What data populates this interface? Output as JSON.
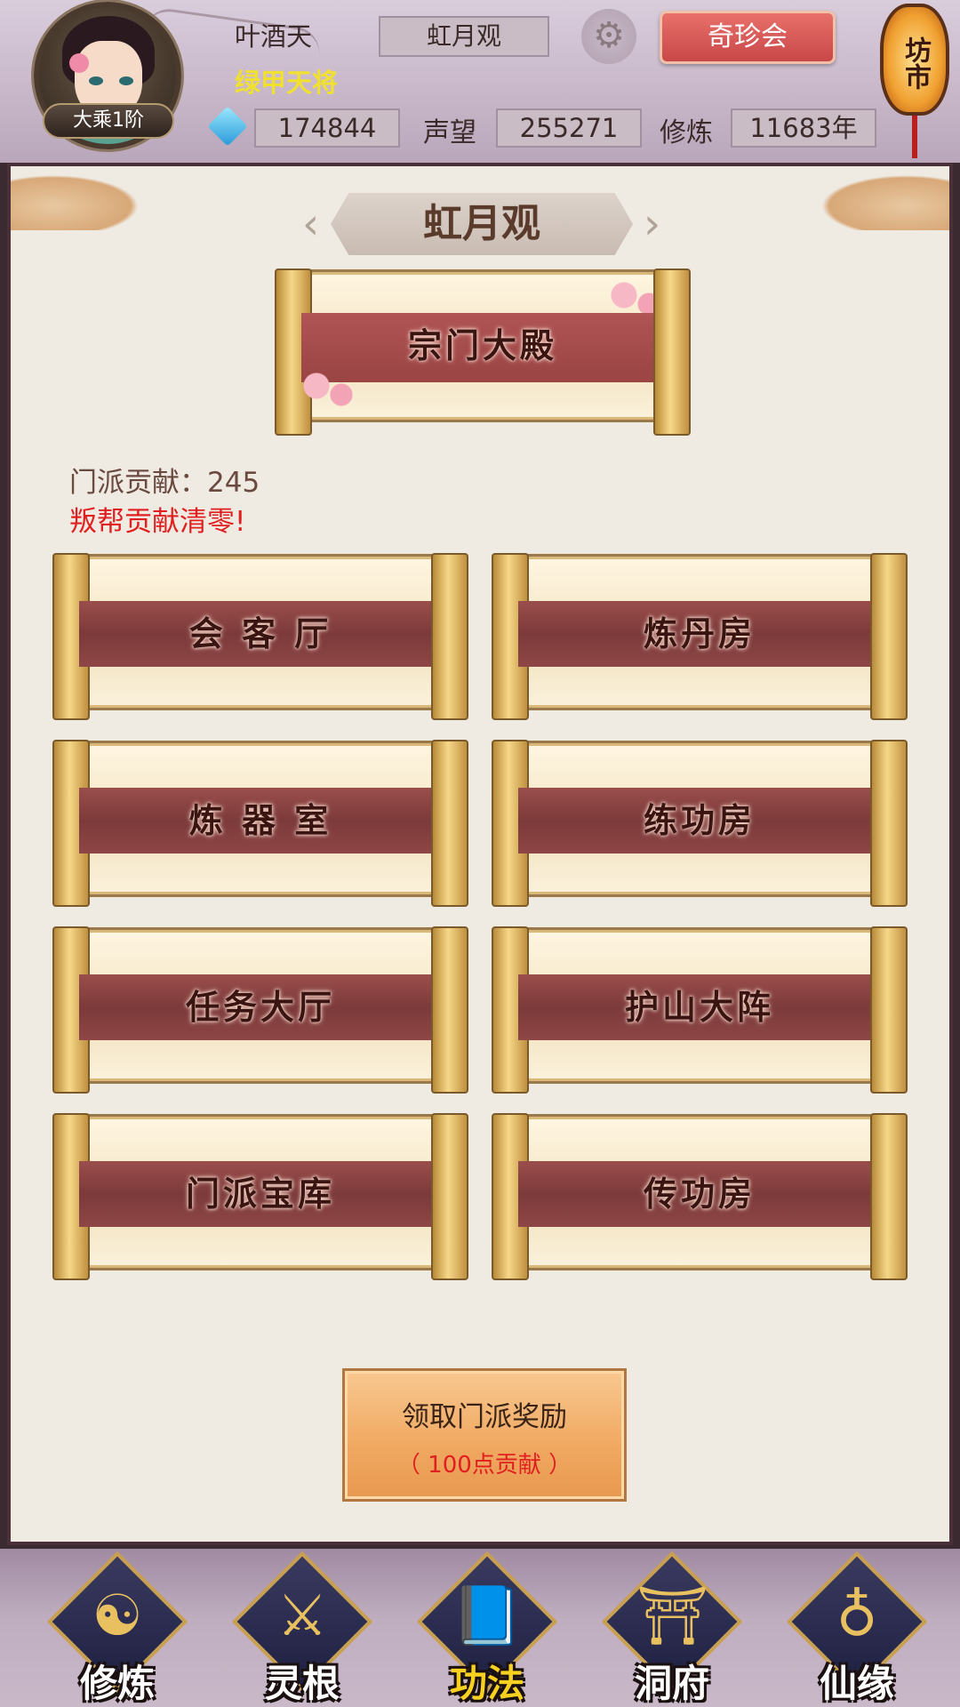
{
  "player": {
    "name": "叶酒天",
    "title": "绿甲天将",
    "rank": "大乘1阶",
    "sect": "虹月观"
  },
  "header": {
    "settings_icon": "gear-icon",
    "treasure_button": "奇珍会",
    "market_lantern": "坊市",
    "currency_icon": "blue-gem-icon",
    "currency_value": "174844",
    "prestige_label": "声望",
    "prestige_value": "255271",
    "cultivation_label": "修炼",
    "cultivation_value": "11683年"
  },
  "sect_panel": {
    "title": "虹月观",
    "main_hall": "宗门大殿",
    "contribution_line": "门派贡献：245",
    "warning": "叛帮贡献清零!",
    "buildings": [
      {
        "label": "会 客 厅"
      },
      {
        "label": "炼丹房"
      },
      {
        "label": "炼 器 室"
      },
      {
        "label": "练功房"
      },
      {
        "label": "任务大厅"
      },
      {
        "label": "护山大阵"
      },
      {
        "label": "门派宝库"
      },
      {
        "label": "传功房"
      }
    ],
    "reward_button": {
      "label": "领取门派奖励",
      "cost": "（ 100点贡献 ）"
    }
  },
  "bottom_nav": {
    "items": [
      {
        "label": "修炼",
        "icon": "cultivator-icon"
      },
      {
        "label": "灵根",
        "icon": "yin-yang-sword-icon"
      },
      {
        "label": "功法",
        "icon": "manual-book-icon",
        "active": true
      },
      {
        "label": "洞府",
        "icon": "pavilion-icon"
      },
      {
        "label": "仙缘",
        "icon": "gourd-icon"
      }
    ]
  },
  "colors": {
    "accent_red": "#e02020",
    "title_yellow": "#f0e030",
    "active_nav": "#f8d020"
  }
}
